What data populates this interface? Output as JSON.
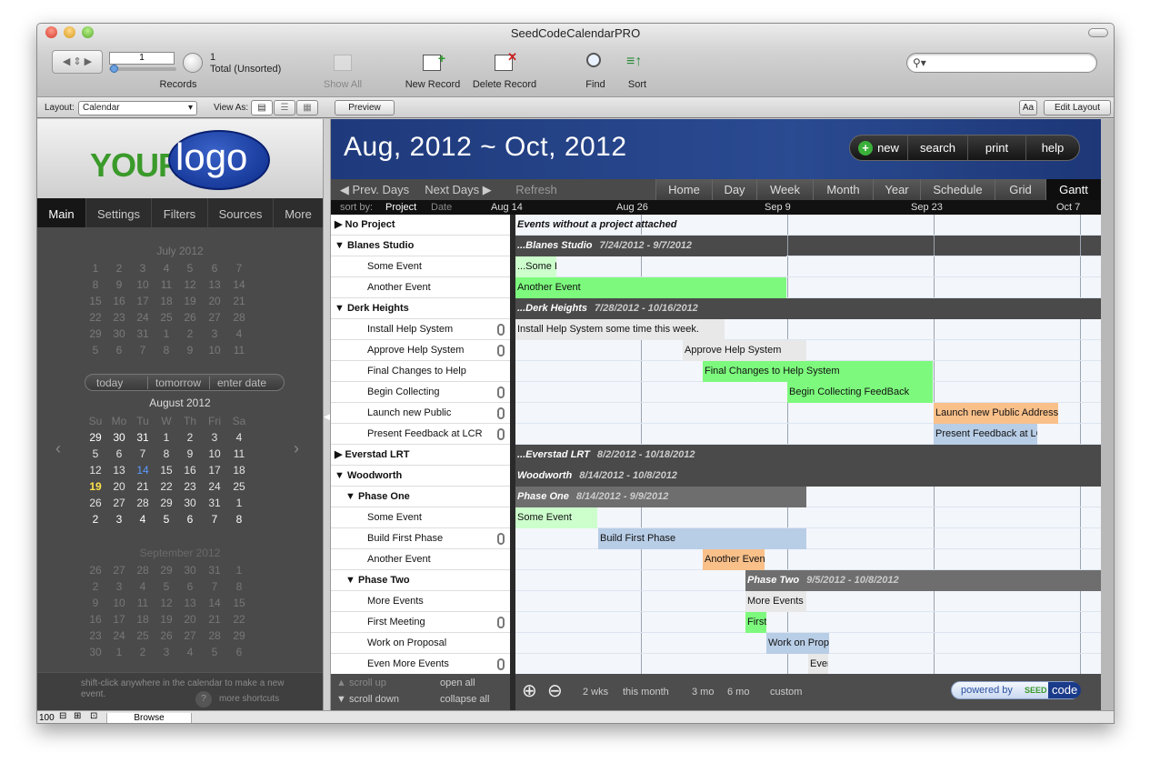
{
  "window": {
    "title": "SeedCodeCalendarPRO"
  },
  "toolbar": {
    "record_value": "1",
    "found_count": "1",
    "total_label": "Total (Unsorted)",
    "records_label": "Records",
    "show_all": "Show All",
    "new_record": "New Record",
    "delete_record": "Delete Record",
    "find": "Find",
    "sort": "Sort",
    "search_placeholder": ""
  },
  "layoutbar": {
    "layout_label": "Layout:",
    "layout_value": "Calendar",
    "view_as_label": "View As:",
    "preview": "Preview",
    "aa": "Aa",
    "edit_layout": "Edit Layout"
  },
  "sidebar": {
    "logo_your": "YOUR",
    "logo_logo": "logo",
    "tabs": [
      "Main",
      "Settings",
      "Filters",
      "Sources",
      "More"
    ],
    "quick": [
      "today",
      "tomorrow",
      "enter date"
    ],
    "hint": "shift-click anywhere in the calendar to make a new event.",
    "more_shortcuts": "more shortcuts",
    "weekdays": [
      "Su",
      "Mo",
      "Tu",
      "W",
      "Th",
      "Fri",
      "Sa"
    ],
    "months": [
      {
        "title": "July 2012",
        "days": [
          "1",
          "2",
          "3",
          "4",
          "5",
          "6",
          "7",
          "8",
          "9",
          "10",
          "11",
          "12",
          "13",
          "14",
          "15",
          "16",
          "17",
          "18",
          "19",
          "20",
          "21",
          "22",
          "23",
          "24",
          "25",
          "26",
          "27",
          "28",
          "29",
          "30",
          "31",
          "1",
          "2",
          "3",
          "4",
          "5",
          "6",
          "7",
          "8",
          "9",
          "10",
          "11"
        ]
      },
      {
        "title": "August 2012",
        "days": [
          "29",
          "30",
          "31",
          "1",
          "2",
          "3",
          "4",
          "5",
          "6",
          "7",
          "8",
          "9",
          "10",
          "11",
          "12",
          "13",
          "14",
          "15",
          "16",
          "17",
          "18",
          "19",
          "20",
          "21",
          "22",
          "23",
          "24",
          "25",
          "26",
          "27",
          "28",
          "29",
          "30",
          "31",
          "1",
          "2",
          "3",
          "4",
          "5",
          "6",
          "7",
          "8"
        ]
      },
      {
        "title": "September 2012",
        "days": [
          "26",
          "27",
          "28",
          "29",
          "30",
          "31",
          "1",
          "2",
          "3",
          "4",
          "5",
          "6",
          "7",
          "8",
          "9",
          "10",
          "11",
          "12",
          "13",
          "14",
          "15",
          "16",
          "17",
          "18",
          "19",
          "20",
          "21",
          "22",
          "23",
          "24",
          "25",
          "26",
          "27",
          "28",
          "29",
          "30",
          "1",
          "2",
          "3",
          "4",
          "5",
          "6"
        ]
      }
    ],
    "today": "19",
    "selected": "14"
  },
  "calendar": {
    "title": "Aug, 2012 ~ Oct, 2012",
    "header_buttons": [
      "new",
      "search",
      "print",
      "help"
    ],
    "prev": "Prev. Days",
    "next": "Next Days",
    "refresh": "Refresh",
    "views": [
      "Home",
      "Day",
      "Week",
      "Month",
      "Year",
      "Schedule",
      "Grid",
      "Gantt"
    ],
    "active_view": "Gantt",
    "sort_by": "sort by:",
    "sort_project": "Project",
    "sort_date": "Date",
    "ticks": [
      "Aug 14",
      "Aug 26",
      "Sep 9",
      "Sep 23",
      "Oct 7"
    ],
    "rows": [
      {
        "label": "▶ No Project",
        "type": "group",
        "bar": "Events without a project attached",
        "dates": ""
      },
      {
        "label": "▼ Blanes Studio",
        "type": "group",
        "bar": "...Blanes Studio",
        "dates": "7/24/2012 - 9/7/2012"
      },
      {
        "label": "Some Event",
        "type": "event",
        "bar": "...Some E"
      },
      {
        "label": "Another Event",
        "type": "event",
        "bar": "Another Event"
      },
      {
        "label": "▼ Derk Heights",
        "type": "group",
        "bar": "...Derk Heights",
        "dates": "7/28/2012 - 10/16/2012"
      },
      {
        "label": "Install Help System",
        "type": "event",
        "bar": "Install Help System some time this week."
      },
      {
        "label": "Approve Help System",
        "type": "event",
        "bar": "Approve Help System"
      },
      {
        "label": "Final Changes to Help",
        "type": "event",
        "bar": "Final Changes to Help System"
      },
      {
        "label": "Begin Collecting",
        "type": "event",
        "bar": "Begin Collecting FeedBack"
      },
      {
        "label": "Launch new Public",
        "type": "event",
        "bar": "Launch new Public Address Sy"
      },
      {
        "label": "Present Feedback at LCR",
        "type": "event",
        "bar": "Present Feedback at LCR"
      },
      {
        "label": "▶ Everstad LRT",
        "type": "group",
        "bar": "...Everstad LRT",
        "dates": "8/2/2012 - 10/18/2012"
      },
      {
        "label": "▼ Woodworth",
        "type": "group",
        "bar": "Woodworth",
        "dates": "8/14/2012 - 10/8/2012"
      },
      {
        "label": "▼ Phase One",
        "type": "subgroup",
        "bar": "Phase One",
        "dates": "8/14/2012 - 9/9/2012"
      },
      {
        "label": "Some Event",
        "type": "event",
        "bar": "Some Event"
      },
      {
        "label": "Build First Phase",
        "type": "event",
        "bar": "Build First Phase"
      },
      {
        "label": "Another Event",
        "type": "event",
        "bar": "Another Event"
      },
      {
        "label": "▼ Phase Two",
        "type": "subgroup",
        "bar": "Phase Two",
        "dates": "9/5/2012 - 10/8/2012"
      },
      {
        "label": "More Events",
        "type": "event",
        "bar": "More Events"
      },
      {
        "label": "First Meeting",
        "type": "event",
        "bar": "First"
      },
      {
        "label": "Work on Proposal",
        "type": "event",
        "bar": "Work on Propos"
      },
      {
        "label": "Even More Events",
        "type": "event",
        "bar": "Even"
      }
    ],
    "footer": {
      "scroll_up": "▲ scroll up",
      "scroll_down": "▼ scroll down",
      "open_all": "open all",
      "collapse_all": "collapse all",
      "ranges": [
        "2 wks",
        "this month",
        "3 mo",
        "6 mo",
        "custom"
      ],
      "powered_by": "powered by",
      "seed": "SEED",
      "code": "code"
    }
  },
  "status": {
    "zoom": "100",
    "mode": "Browse"
  }
}
